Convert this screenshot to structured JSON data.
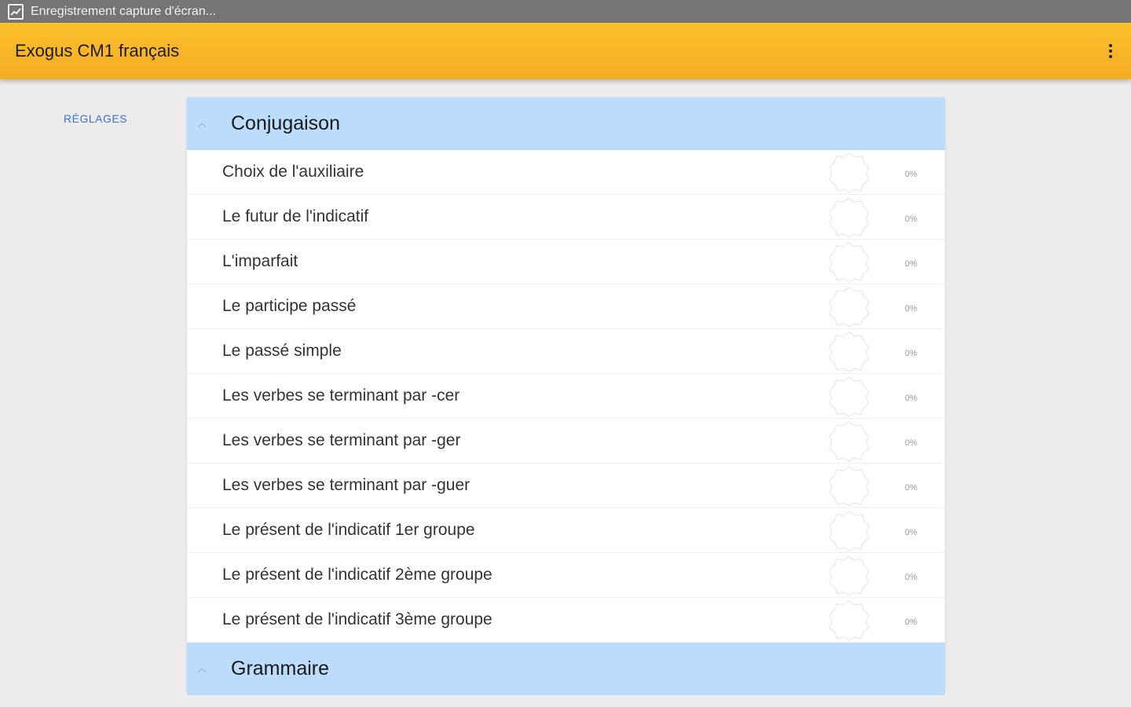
{
  "status_bar": {
    "notification_text": "Enregistrement capture d'écran..."
  },
  "toolbar": {
    "title": "Exogus CM1 français"
  },
  "sidebar": {
    "settings_label": "RÉGLAGES"
  },
  "sections": [
    {
      "title": "Conjugaison",
      "items": [
        {
          "label": "Choix de l'auxiliaire",
          "progress": "0%"
        },
        {
          "label": "Le futur de l'indicatif",
          "progress": "0%"
        },
        {
          "label": "L'imparfait",
          "progress": "0%"
        },
        {
          "label": "Le participe passé",
          "progress": "0%"
        },
        {
          "label": "Le passé simple",
          "progress": "0%"
        },
        {
          "label": "Les verbes se terminant par -cer",
          "progress": "0%"
        },
        {
          "label": "Les verbes se terminant par -ger",
          "progress": "0%"
        },
        {
          "label": "Les verbes se terminant par -guer",
          "progress": "0%"
        },
        {
          "label": "Le présent de l'indicatif 1er groupe",
          "progress": "0%"
        },
        {
          "label": "Le présent de l'indicatif 2ème groupe",
          "progress": "0%"
        },
        {
          "label": "Le présent de l'indicatif 3ème groupe",
          "progress": "0%"
        }
      ]
    },
    {
      "title": "Grammaire",
      "items": []
    }
  ],
  "colors": {
    "toolbar": "#fbc02d",
    "section_header": "#bbdcfb",
    "settings_link": "#3f6fcf"
  }
}
